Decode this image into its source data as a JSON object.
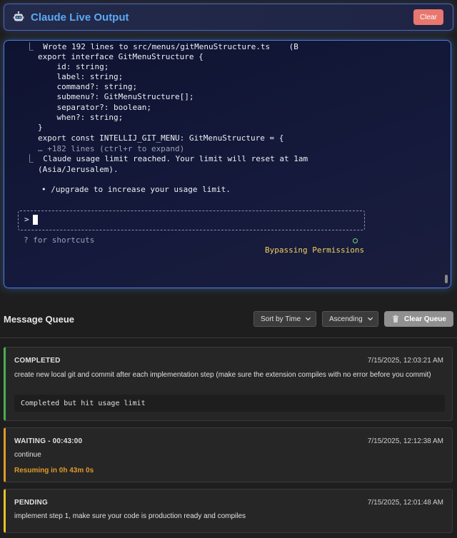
{
  "header": {
    "title": "Claude Live Output",
    "clear_label": "Clear",
    "robot_icon": "robot-icon"
  },
  "terminal": {
    "lines": [
      "⎿  Wrote 192 lines to src/menus/gitMenuStructure.ts    (B",
      "export interface GitMenuStructure {",
      "    id: string;",
      "    label: string;",
      "    command?: string;",
      "    submenu?: GitMenuStructure[];",
      "    separator?: boolean;",
      "    when?: string;",
      "}",
      "export const INTELLIJ_GIT_MENU: GitMenuStructure = {",
      "… +182 lines (ctrl+r to expand)",
      "⎿  Claude usage limit reached. Your limit will reset at 1am",
      "(Asia/Jerusalem).",
      "• /upgrade to increase your usage limit."
    ],
    "prompt_symbol": ">",
    "shortcuts_hint": "? for shortcuts",
    "bypass_text": "Bypassing Permissions"
  },
  "queue": {
    "title": "Message Queue",
    "sort_by": "Sort by Time",
    "order": "Ascending",
    "clear_label": "Clear Queue",
    "items": [
      {
        "status": "COMPLETED",
        "timestamp": "7/15/2025, 12:03:21 AM",
        "message": "create new local git and commit after each implementation step (make sure the extension compiles with no error before you commit)",
        "result": "Completed but hit usage limit",
        "color": "#4caf50"
      },
      {
        "status": "WAITING - 00:43:00",
        "timestamp": "7/15/2025, 12:12:38 AM",
        "message": "continue",
        "resume": "Resuming in 0h 43m 0s",
        "color": "#e09a28"
      },
      {
        "status": "PENDING",
        "timestamp": "7/15/2025, 12:01:48 AM",
        "message": "implement step 1, make sure your code is production ready and compiles",
        "color": "#e6c229"
      }
    ]
  },
  "colors": {
    "accent": "#5aaaf5",
    "clear_button": "#e8776f",
    "terminal_border": "#4a7fe0"
  }
}
